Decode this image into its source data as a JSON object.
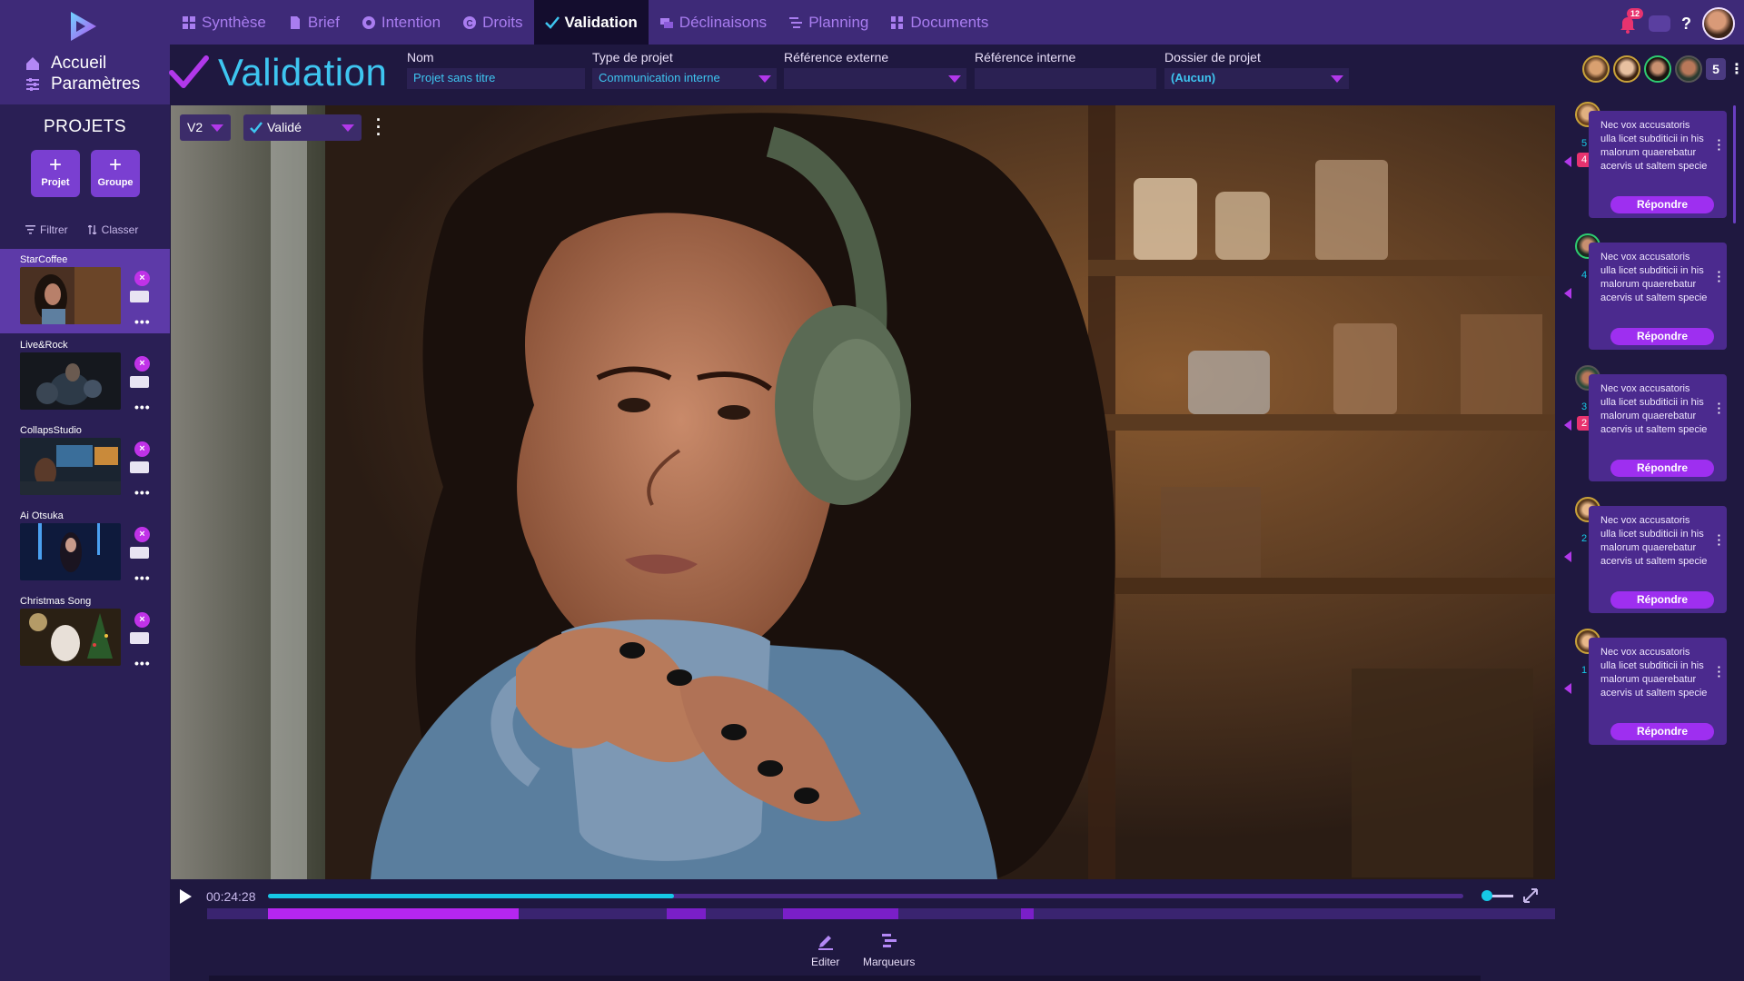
{
  "nav": {
    "items": [
      {
        "label": "Synthèse",
        "icon": "grid-icon"
      },
      {
        "label": "Brief",
        "icon": "document-icon"
      },
      {
        "label": "Intention",
        "icon": "target-icon"
      },
      {
        "label": "Droits",
        "icon": "copyright-icon"
      },
      {
        "label": "Validation",
        "icon": "check-icon",
        "active": true
      },
      {
        "label": "Déclinaisons",
        "icon": "layers-icon"
      },
      {
        "label": "Planning",
        "icon": "list-icon"
      },
      {
        "label": "Documents",
        "icon": "folders-icon"
      }
    ],
    "notification_count": "12"
  },
  "sidebar": {
    "home_label": "Accueil",
    "settings_label": "Paramètres",
    "projects_title": "PROJETS",
    "new_project_label": "Projet",
    "new_group_label": "Groupe",
    "filter_label": "Filtrer",
    "sort_label": "Classer",
    "projects": [
      {
        "name": "StarCoffee",
        "selected": true
      },
      {
        "name": "Live&Rock"
      },
      {
        "name": "CollapsStudio"
      },
      {
        "name": "Ai Otsuka"
      },
      {
        "name": "Christmas Song"
      }
    ]
  },
  "header": {
    "title": "Validation",
    "fields": {
      "nom": {
        "label": "Nom",
        "value": "Projet sans titre"
      },
      "type": {
        "label": "Type de projet",
        "value": "Communication interne"
      },
      "ref_ext": {
        "label": "Référence externe",
        "value": ""
      },
      "ref_int": {
        "label": "Référence interne",
        "value": ""
      },
      "dossier": {
        "label": "Dossier de projet",
        "value": "(Aucun)"
      }
    },
    "participant_count": "5"
  },
  "player": {
    "version": "V2",
    "status": "Validé",
    "timecode": "00:24:28",
    "progress": 0.34,
    "volume": 0.2,
    "markers": [
      {
        "start": 0.0,
        "end": 0.195,
        "color": "#b526f0"
      },
      {
        "start": 0.31,
        "end": 0.34,
        "color": "#7a1fc8"
      },
      {
        "start": 0.4,
        "end": 0.49,
        "color": "#7a1fc8"
      },
      {
        "start": 0.585,
        "end": 0.595,
        "color": "#7a1fc8"
      }
    ]
  },
  "tools": {
    "edit_label": "Editer",
    "markers_label": "Marqueurs"
  },
  "comments": [
    {
      "num": "5",
      "badge": "4",
      "text": "Nec vox accusatoris ulla licet subditicii in his malorum quaerebatur acervis ut saltem specie",
      "reply_label": "Répondre"
    },
    {
      "num": "4",
      "badge": "",
      "text": "Nec vox accusatoris ulla licet subditicii in his malorum quaerebatur acervis ut saltem specie",
      "reply_label": "Répondre"
    },
    {
      "num": "3",
      "badge": "2",
      "text": "Nec vox accusatoris ulla licet subditicii in his malorum quaerebatur acervis ut saltem specie",
      "reply_label": "Répondre"
    },
    {
      "num": "2",
      "badge": "",
      "text": "Nec vox accusatoris ulla licet subditicii in his malorum quaerebatur acervis ut saltem specie",
      "reply_label": "Répondre"
    },
    {
      "num": "1",
      "badge": "",
      "text": "Nec vox accusatoris ulla licet subditicii in his malorum quaerebatur acervis ut saltem specie",
      "reply_label": "Répondre"
    }
  ],
  "colors": {
    "accent": "#b138ea",
    "cyan": "#16c8e6",
    "nav_bg": "#3e2a78",
    "page_bg": "#1f1840"
  }
}
